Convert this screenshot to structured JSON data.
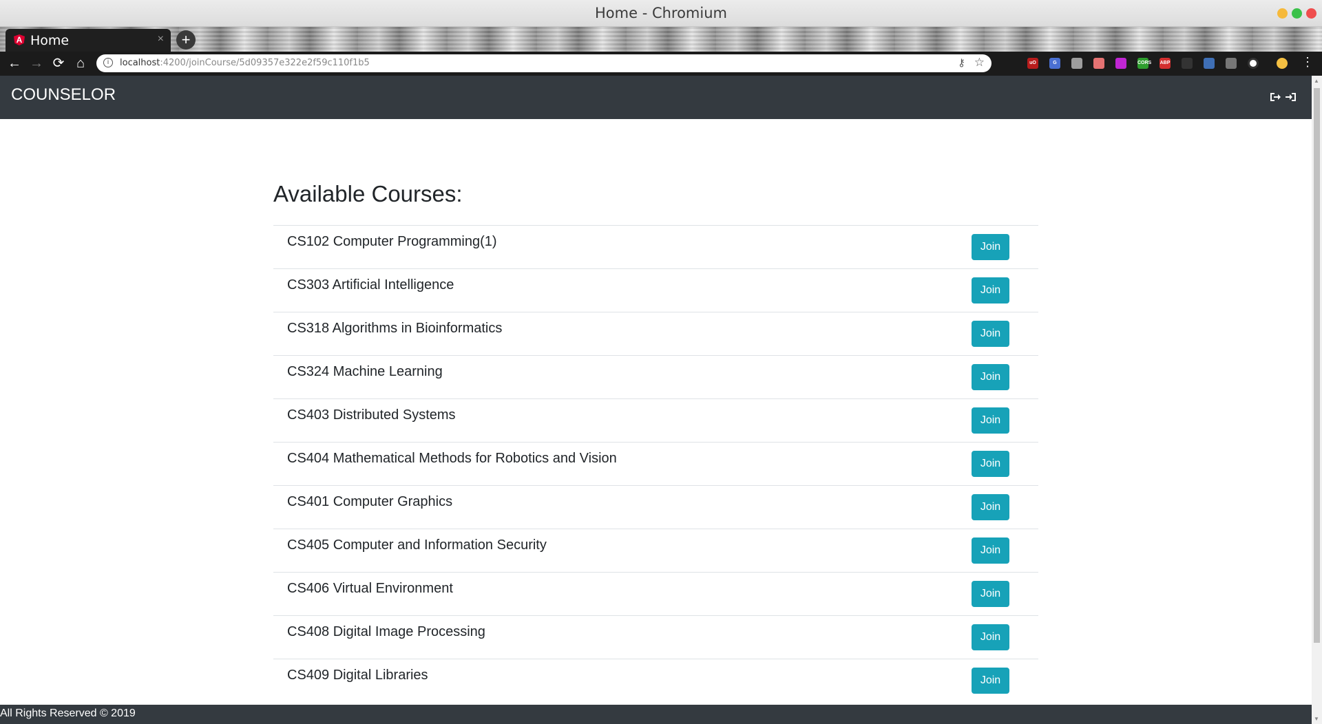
{
  "window": {
    "title": "Home - Chromium"
  },
  "browser": {
    "tab": {
      "label": "Home",
      "close": "×",
      "favicon_letter": "A",
      "favicon_icon": "angular-icon"
    },
    "new_tab": "+",
    "nav": {
      "back": "←",
      "forward": "→",
      "reload": "⟳",
      "home": "⌂",
      "menu": "⋮"
    },
    "address": {
      "host": "localhost",
      "path": ":4200/joinCourse/5d09357e322e2f59c110f1b5"
    },
    "extensions": [
      {
        "name": "ublock-extension-icon",
        "label": "uO",
        "color": "#b71c1c"
      },
      {
        "name": "translate-extension-icon",
        "label": "G",
        "color": "#4a6fd1"
      },
      {
        "name": "notes-extension-icon",
        "label": "",
        "color": "#9e9e9e"
      },
      {
        "name": "pen-extension-icon",
        "label": "",
        "color": "#e57373"
      },
      {
        "name": "palette-extension-icon",
        "label": "",
        "color": "#c026d3"
      },
      {
        "name": "cors-extension-icon",
        "label": "CORS",
        "color": "#2e9e2e"
      },
      {
        "name": "adblock-extension-icon",
        "label": "ABP",
        "color": "#d32f2f"
      },
      {
        "name": "feather-extension-icon",
        "label": "",
        "color": "#333333"
      },
      {
        "name": "plus-extension-icon",
        "label": "",
        "color": "#3f6fb5"
      },
      {
        "name": "download-extension-icon",
        "label": "",
        "color": "#777777"
      },
      {
        "name": "chrome-extension-icon",
        "label": "",
        "color": "#ffffff"
      },
      {
        "name": "profile-avatar-icon",
        "label": "",
        "color": "#f5c042"
      }
    ]
  },
  "navbar": {
    "brand": "COUNSELOR",
    "icons": [
      "sign-out-icon",
      "sign-in-icon"
    ]
  },
  "main": {
    "heading": "Available Courses:",
    "join_label": "Join",
    "courses": [
      "CS102 Computer Programming(1)",
      "CS303 Artificial Intelligence",
      "CS318 Algorithms in Bioinformatics",
      "CS324 Machine Learning",
      "CS403 Distributed Systems",
      "CS404 Mathematical Methods for Robotics and Vision",
      "CS401 Computer Graphics",
      "CS405 Computer and Information Security",
      "CS406 Virtual Environment",
      "CS408 Digital Image Processing",
      "CS409 Digital Libraries"
    ]
  },
  "footer": {
    "text": "All Rights Reserved © 2019"
  },
  "colors": {
    "navbar": "#343a40",
    "button": "#17a2b8",
    "text": "#212529",
    "row_border": "#dee2e6"
  }
}
